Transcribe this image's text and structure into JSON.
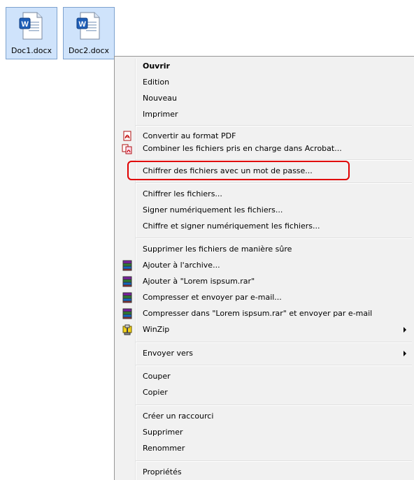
{
  "files": [
    {
      "name": "Doc1.docx",
      "icon": "word-document-icon"
    },
    {
      "name": "Doc2.docx",
      "icon": "word-document-icon"
    }
  ],
  "menu": {
    "ouvrir": "Ouvrir",
    "edition": "Edition",
    "nouveau": "Nouveau",
    "imprimer": "Imprimer",
    "convertir_pdf": "Convertir au format PDF",
    "combiner_acrobat": "Combiner les fichiers pris en charge dans Acrobat...",
    "chiffrer_mdp": "Chiffrer des fichiers avec un mot de passe...",
    "chiffrer_fichiers": "Chiffrer les fichiers...",
    "signer": "Signer numériquement les fichiers...",
    "chiffrer_signer": "Chiffre et signer numériquement les fichiers...",
    "supprimer_sure": "Supprimer les fichiers de manière sûre",
    "ajouter_archive": "Ajouter à l'archive...",
    "ajouter_rar": "Ajouter à \"Lorem ispsum.rar\"",
    "compresser_email": "Compresser et envoyer par e-mail...",
    "compresser_rar_email": "Compresser dans \"Lorem ispsum.rar\" et envoyer par e-mail",
    "winzip": "WinZip",
    "envoyer_vers": "Envoyer vers",
    "couper": "Couper",
    "copier": "Copier",
    "creer_raccourci": "Créer un raccourci",
    "supprimer": "Supprimer",
    "renommer": "Renommer",
    "proprietes": "Propriétés"
  },
  "colors": {
    "highlight": "#e00000",
    "selection_bg": "#cfe3fb",
    "menu_bg": "#f1f1f1"
  }
}
